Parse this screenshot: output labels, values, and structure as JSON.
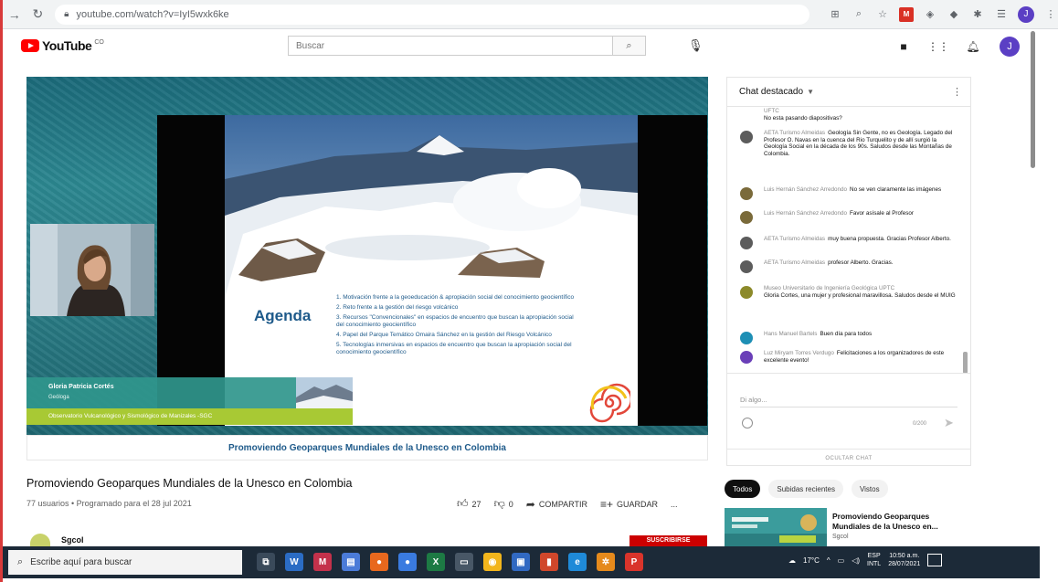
{
  "browser": {
    "url": "youtube.com/watch?v=IyI5wxk6ke",
    "profile_initial": "J"
  },
  "youtube": {
    "logo_text": "YouTube",
    "logo_country": "CO",
    "search_placeholder": "Buscar",
    "avatar_initial": "J"
  },
  "video": {
    "slide_title": "Agenda",
    "agenda_items": [
      "1. Motivación frente a la geoeducación & apropiación social del conocimiento geocientífico",
      "2. Reto frente a la gestión del riesgo volcánico",
      "3. Recursos \"Convencionales\" en espacios de encuentro que buscan la apropiación social del conocimiento geocientífico",
      "4. Papel del Parque Temático Omaira Sánchez en la gestión del Riesgo Volcánico",
      "5. Tecnologías inmersivas en espacios de encuentro que buscan la apropiación social del conocimiento geocientífico"
    ],
    "presenter_name": "Gloria Patricia Cortés",
    "presenter_role": "Geóloga",
    "presenter_org": "Observatorio Vulcanológico y Sismológico de Manizales -SGC",
    "caption": "Promoviendo Geoparques Mundiales de la Unesco en Colombia"
  },
  "info": {
    "title": "Promoviendo Geoparques Mundiales de la Unesco en Colombia",
    "meta": "77 usuarios • Programado para el 28 jul 2021",
    "likes": "27",
    "dislikes": "0",
    "share": "COMPARTIR",
    "save": "GUARDAR",
    "more": "...",
    "channel_name": "Sgcol",
    "subscribe": "SUSCRIBIRSE"
  },
  "chat": {
    "header": "Chat destacado",
    "messages": [
      {
        "author": "UFTC",
        "text": "No esta pasando diapositivas?",
        "color": "#8a8a8a"
      },
      {
        "author": "AETA Turismo Almeidas",
        "text": "Geología Sin Gente, no es Geología. Legado del Profesor O. Navas en la cuenca del Rio Turquelito y de allí surgió la Geología Social en la década de los 90s. Saludos desde las Montañas de Colombia.",
        "color": "#5c5c5c"
      },
      {
        "author": "Luis Hernán Sánchez Arredondo",
        "text": "No se ven claramente las imágenes",
        "color": "#7a6a3a"
      },
      {
        "author": "Luis Hernán Sánchez Arredondo",
        "text": "Favor asísale al Profesor",
        "color": "#7a6a3a"
      },
      {
        "author": "AETA Turismo Almeidas",
        "text": "muy buena propuesta. Gracias Profesor Alberto.",
        "color": "#5c5c5c"
      },
      {
        "author": "AETA Turismo Almeidas",
        "text": "profesor Alberto. Gracias.",
        "color": "#5c5c5c"
      },
      {
        "author": "Museo Universitario de Ingeniería Geológica UPTC",
        "text": "Gloria Cortes, una mujer y profesional maravillosa. Saludos desde el MUIG",
        "color": "#8c8a2a"
      },
      {
        "author": "Hans Manuel Bartels",
        "text": "Buen día para todos",
        "color": "#1e8fb5"
      },
      {
        "author": "Luz Miryam Torres Verdugo",
        "text": "Felicitaciones a los organizadores de este excelente evento!",
        "color": "#6a3fb8"
      }
    ],
    "input_placeholder": "Di algo...",
    "char_count": "0/200",
    "hide_chat": "OCULTAR CHAT"
  },
  "recommendations": {
    "chips": [
      "Todos",
      "Subidas recientes",
      "Vistos"
    ],
    "item_title": "Promoviendo Geoparques Mundiales de la Unesco en...",
    "item_channel": "Sgcol"
  },
  "taskbar": {
    "search_placeholder": "Escribe aquí para buscar",
    "temperature": "17°C",
    "lang": "ESP",
    "lang2": "INTL",
    "time": "10:50 a.m.",
    "date": "28/07/2021"
  }
}
